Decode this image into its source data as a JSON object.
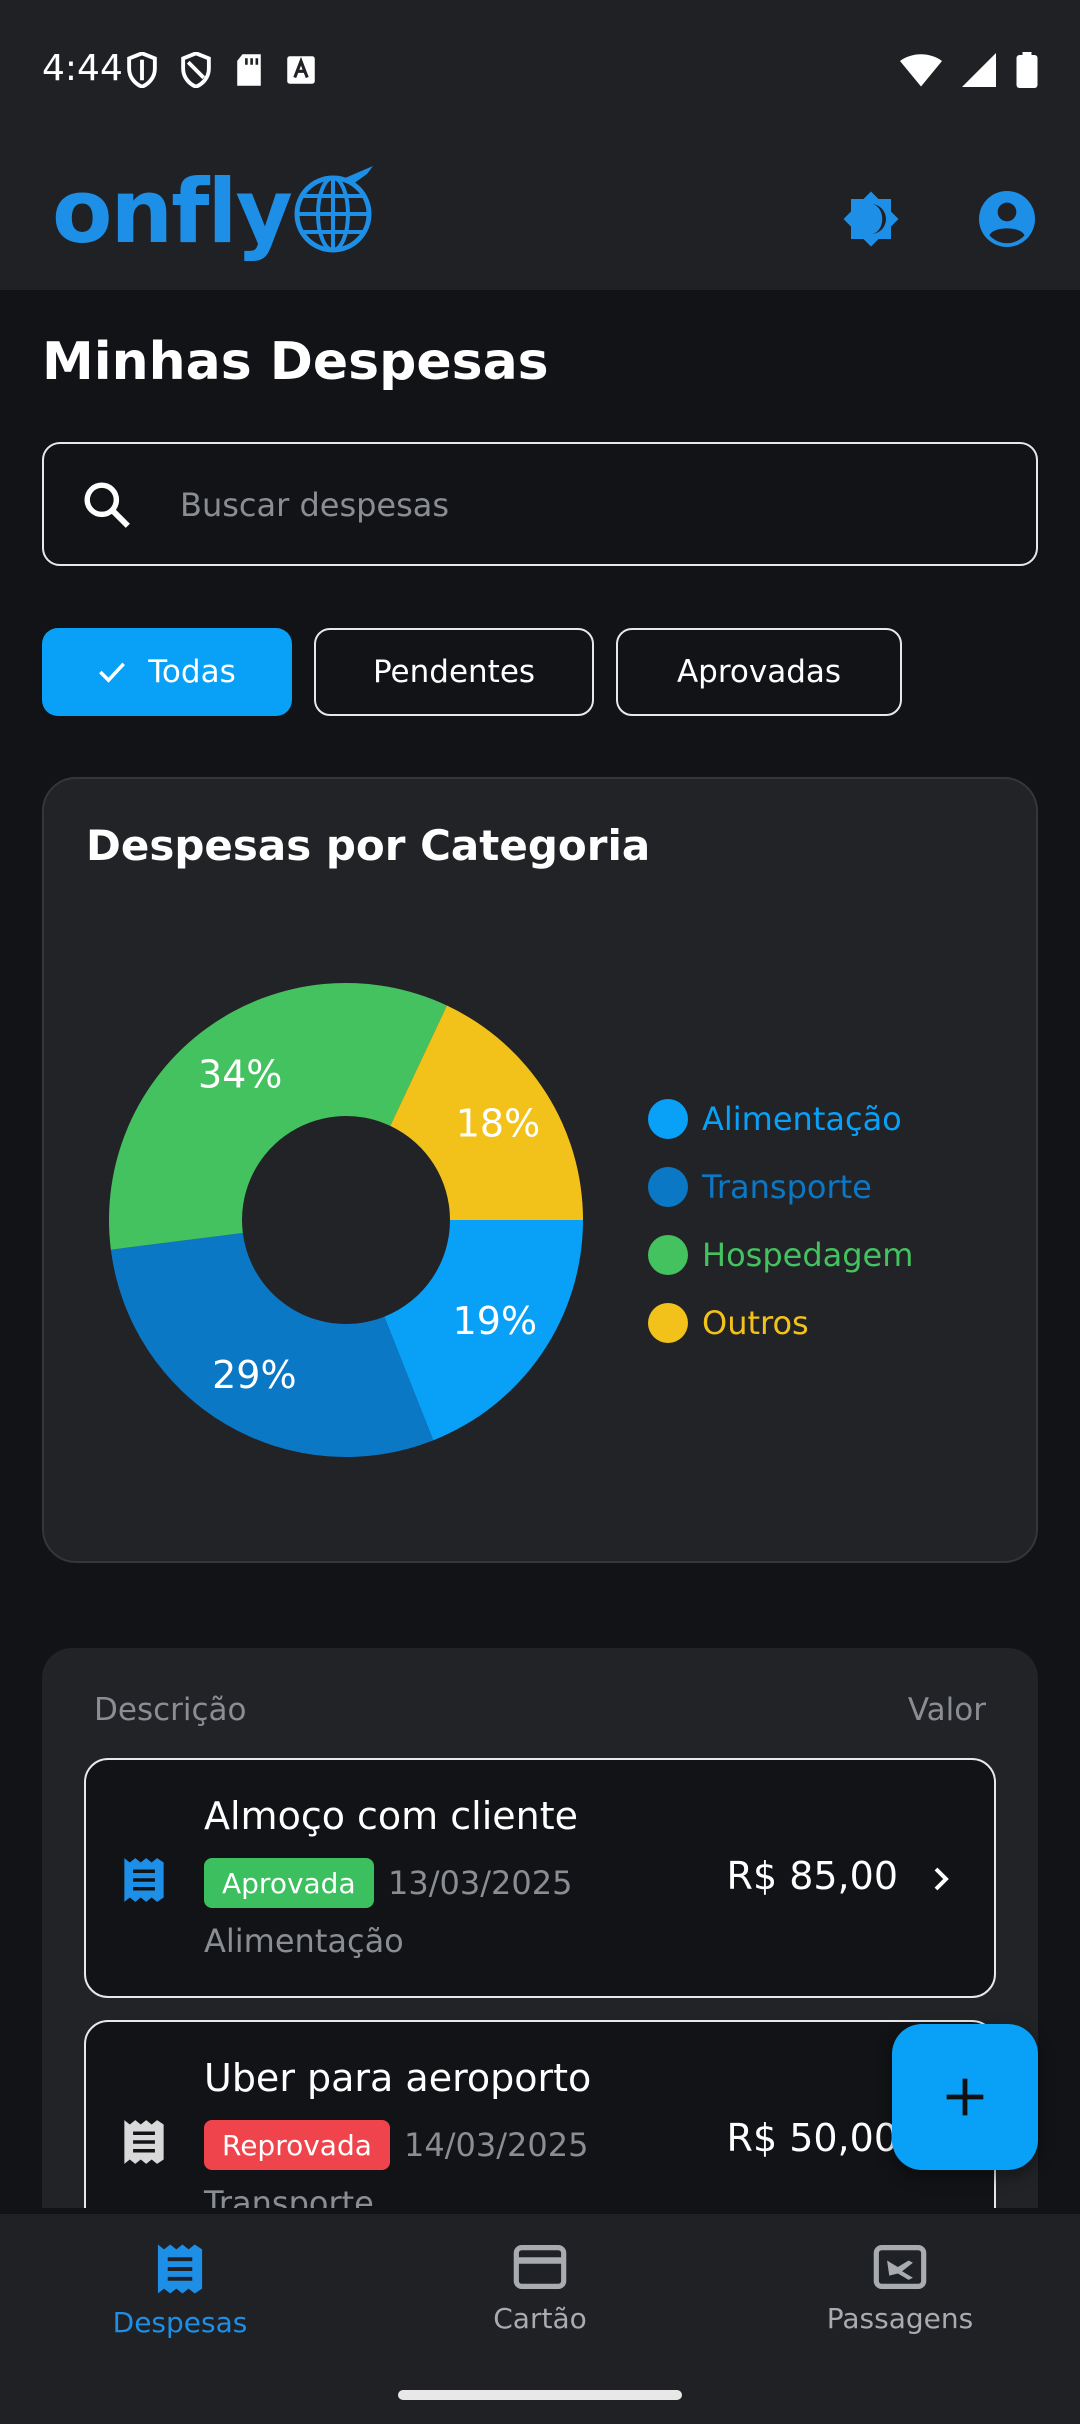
{
  "status_bar": {
    "time": "4:44"
  },
  "app_bar": {
    "logo_text": "onfly"
  },
  "page": {
    "title": "Minhas Despesas"
  },
  "search": {
    "placeholder": "Buscar despesas"
  },
  "filters": [
    {
      "label": "Todas",
      "selected": true
    },
    {
      "label": "Pendentes",
      "selected": false
    },
    {
      "label": "Aprovadas",
      "selected": false
    }
  ],
  "chart_data": {
    "type": "pie",
    "title": "Despesas por Categoria",
    "donut": true,
    "legend_position": "right",
    "categories": [
      "Alimentação",
      "Transporte",
      "Hospedagem",
      "Outros"
    ],
    "values": [
      19,
      29,
      34,
      18
    ],
    "labels": [
      "19%",
      "29%",
      "34%",
      "18%"
    ],
    "colors": [
      "#09a0f7",
      "#0b78c6",
      "#43c25f",
      "#f2c21b"
    ]
  },
  "list": {
    "header_description": "Descrição",
    "header_value": "Valor",
    "rows": [
      {
        "title": "Almoço com cliente",
        "status": "Aprovada",
        "date": "13/03/2025",
        "category": "Alimentação",
        "amount": "R$ 85,00",
        "icon_color": "#1d8fe6"
      },
      {
        "title": "Uber para aeroporto",
        "status": "Reprovada",
        "date": "14/03/2025",
        "category": "Transporte",
        "amount": "R$ 50,00",
        "icon_color": "#d9d9d9"
      }
    ]
  },
  "bottom_nav": [
    {
      "label": "Despesas",
      "active": true,
      "icon": "receipt-icon"
    },
    {
      "label": "Cartão",
      "active": false,
      "icon": "credit-card-icon"
    },
    {
      "label": "Passagens",
      "active": false,
      "icon": "airplane-ticket-icon"
    }
  ],
  "colors": {
    "accent": "#09a0f7",
    "brand": "#1d8fe6",
    "approved": "#3cbf5e",
    "rejected": "#f0444d"
  }
}
